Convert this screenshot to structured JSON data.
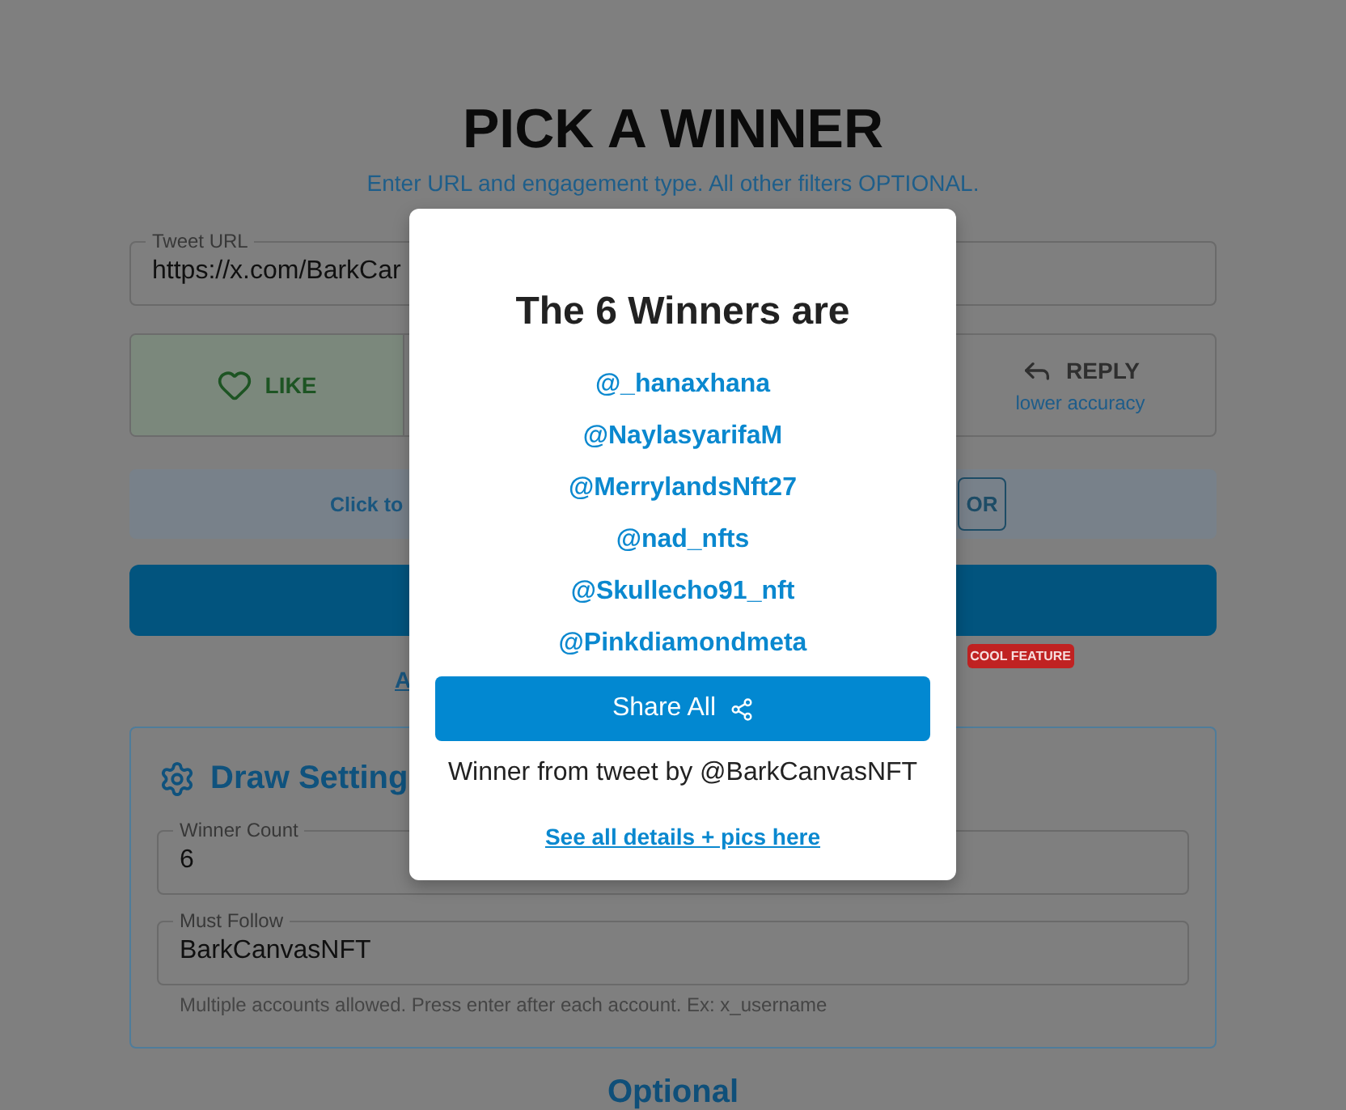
{
  "page": {
    "title": "PICK A WINNER",
    "subtitle": "Enter URL and engagement type. All other filters OPTIONAL."
  },
  "tweet_url": {
    "label": "Tweet URL",
    "value": "https://x.com/BarkCar"
  },
  "engagement_types": [
    {
      "kind": "like",
      "label": "LIKE",
      "selected": true
    },
    {
      "kind": "reply",
      "label": "REPLY",
      "note": "lower accuracy",
      "selected": false
    }
  ],
  "filter_bar": {
    "text": "Click to",
    "toggle": "OR"
  },
  "feature_link": {
    "text": "A",
    "badge": "COOL FEATURE"
  },
  "draw_settings": {
    "title": "Draw Setting",
    "fields": [
      {
        "label": "Winner Count",
        "value": "6"
      },
      {
        "label": "Must Follow",
        "value": "BarkCanvasNFT",
        "help": "Multiple accounts allowed. Press enter after each account. Ex: x_username"
      }
    ]
  },
  "optional_heading": "Optional",
  "modal": {
    "title": "The 6 Winners are",
    "winners": [
      "@_hanaxhana",
      "@NaylasyarifaM",
      "@MerrylandsNft27",
      "@nad_nfts",
      "@Skullecho91_nft",
      "@Pinkdiamondmeta"
    ],
    "share_button": "Share All",
    "source": "Winner from tweet by @BarkCanvasNFT",
    "details_link": "See all details + pics here"
  }
}
